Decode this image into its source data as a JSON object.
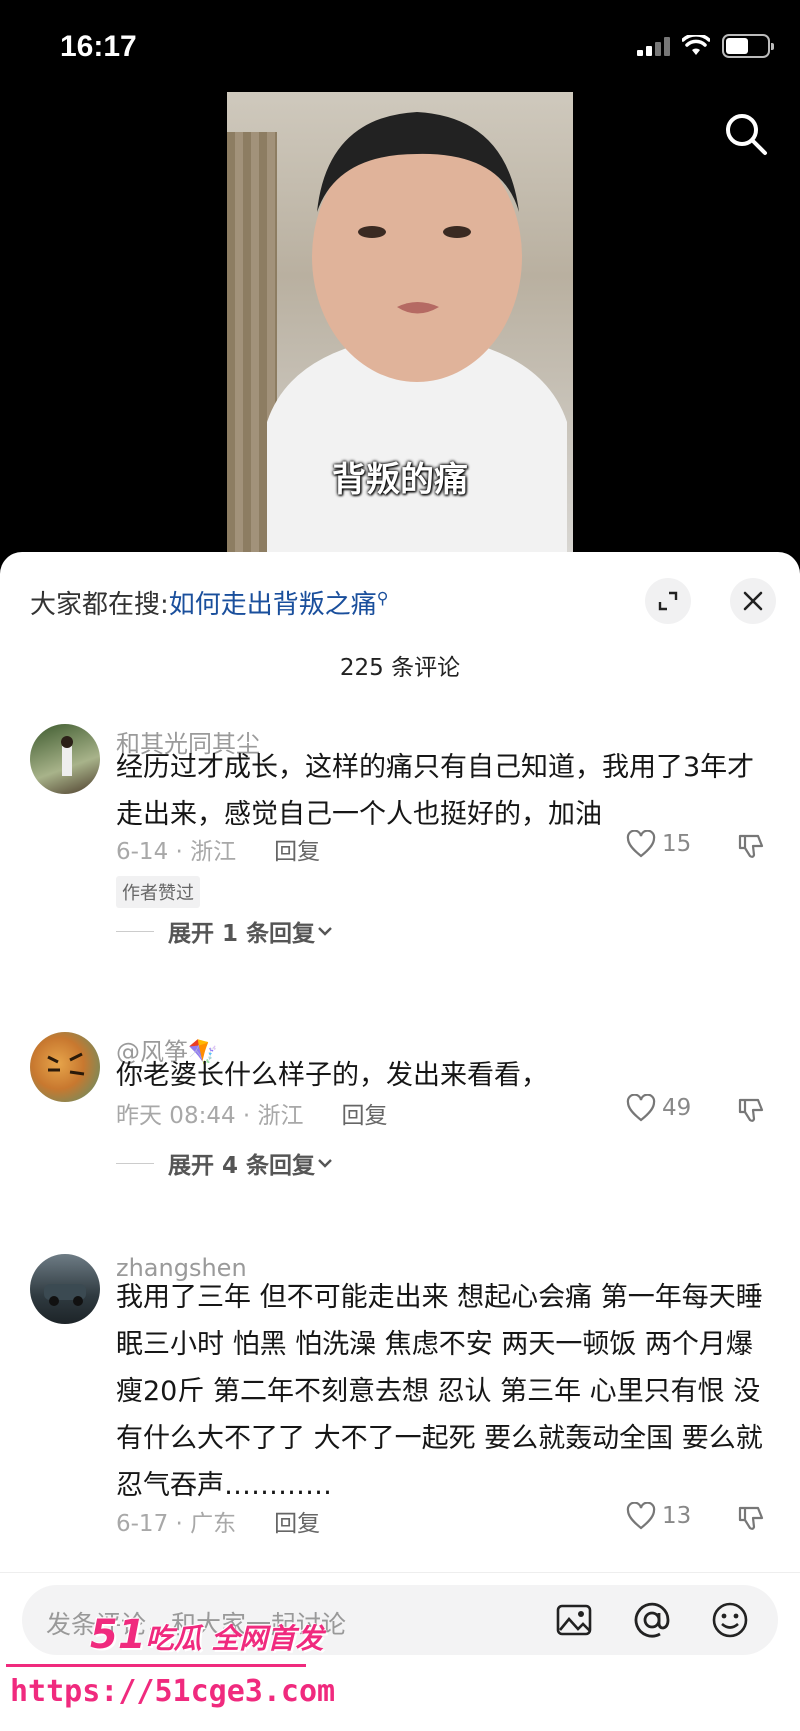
{
  "status_bar": {
    "time": "16:17"
  },
  "video": {
    "subtitle": "背叛的痛"
  },
  "sheet": {
    "hot_search_prefix": "大家都在搜:",
    "hot_search_term": "如何走出背叛之痛",
    "comment_count": "225 条评论"
  },
  "comments": [
    {
      "username": "和其光同其尘",
      "content": "经历过才成长，这样的痛只有自己知道，我用了3年才走出来，感觉自己一个人也挺好的，加油",
      "meta": "6-14 · 浙江",
      "reply_label": "回复",
      "likes": "15",
      "badge": "作者赞过",
      "expand_label": "展开 1 条回复"
    },
    {
      "username": "@风筝🪁",
      "content": "你老婆长什么样子的，发出来看看，",
      "meta": "昨天 08:44 · 浙江",
      "reply_label": "回复",
      "likes": "49",
      "expand_label": "展开 4 条回复"
    },
    {
      "username": "zhangshen",
      "content": "我用了三年 但不可能走出来 想起心会痛  第一年每天睡眠三小时 怕黑 怕洗澡 焦虑不安 两天一顿饭 两个月爆瘦20斤  第二年不刻意去想 忍认 第三年 心里只有恨 没有什么大不了了  大不了一起死 要么就轰动全国 要么就忍气吞声…………",
      "meta": "6-17 · 广东",
      "reply_label": "回复",
      "likes": "13"
    }
  ],
  "input": {
    "placeholder": "发条评论，和大家一起讨论"
  },
  "watermark": {
    "brand_num": "51",
    "brand_text": "吃瓜 全网首发",
    "url": "https://51cge3.com"
  },
  "colors": {
    "link_blue": "#1a4f9c",
    "watermark_pink": "#f02a7e"
  },
  "icons": [
    "search-icon",
    "expand-icon",
    "close-icon",
    "heart-icon",
    "dislike-icon",
    "chevron-down-icon",
    "image-icon",
    "at-icon",
    "emoji-icon"
  ]
}
